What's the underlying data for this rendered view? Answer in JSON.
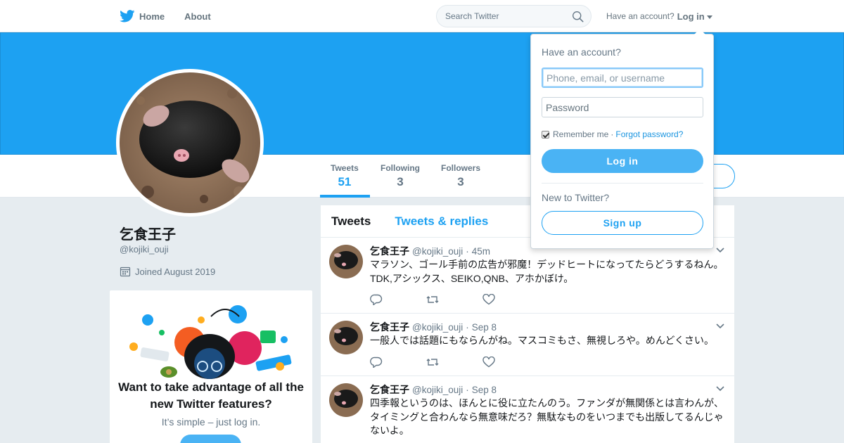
{
  "nav": {
    "home_label": "Home",
    "about_label": "About",
    "search_placeholder": "Search Twitter",
    "have_account_label": "Have an account?",
    "login_label": "Log in"
  },
  "profile": {
    "display_name": "乞食王子",
    "handle": "@kojiki_ouji",
    "joined": "Joined August 2019",
    "stats": [
      {
        "label": "Tweets",
        "value": "51"
      },
      {
        "label": "Following",
        "value": "3"
      },
      {
        "label": "Followers",
        "value": "3"
      }
    ]
  },
  "promo": {
    "title": "Want to take advantage of all the new Twitter features?",
    "subtitle": "It’s simple – just log in."
  },
  "timeline": {
    "tabs": [
      "Tweets",
      "Tweets & replies"
    ],
    "tweets": [
      {
        "name": "乞食王子",
        "handle": "@kojiki_ouji",
        "time": "45m",
        "text": "マラソン、ゴール手前の広告が邪魔！デッドヒートになってたらどうするねん。TDK,アシックス、SEIKO,QNB、アホかぼけ。"
      },
      {
        "name": "乞食王子",
        "handle": "@kojiki_ouji",
        "time": "Sep 8",
        "text": "一般人では話題にもならんがね。マスコミもさ、無視しろや。めんどくさい。"
      },
      {
        "name": "乞食王子",
        "handle": "@kojiki_ouji",
        "time": "Sep 8",
        "text": "四季報というのは、ほんとに役に立たんのう。ファンダが無関係とは言わんが、タイミングと合わんなら無意味だろ？無駄なものをいつまでも出版してるんじゃないよ。"
      }
    ]
  },
  "login_dropdown": {
    "title": "Have an account?",
    "username_placeholder": "Phone, email, or username",
    "password_placeholder": "Password",
    "remember_label": "Remember me",
    "separator": "·",
    "forgot_label": "Forgot password?",
    "login_button": "Log in",
    "new_label": "New to Twitter?",
    "signup_button": "Sign up"
  },
  "colors": {
    "brand_blue": "#1da1f2",
    "button_blue": "#4ab3f4",
    "background": "#e6ecf0"
  }
}
